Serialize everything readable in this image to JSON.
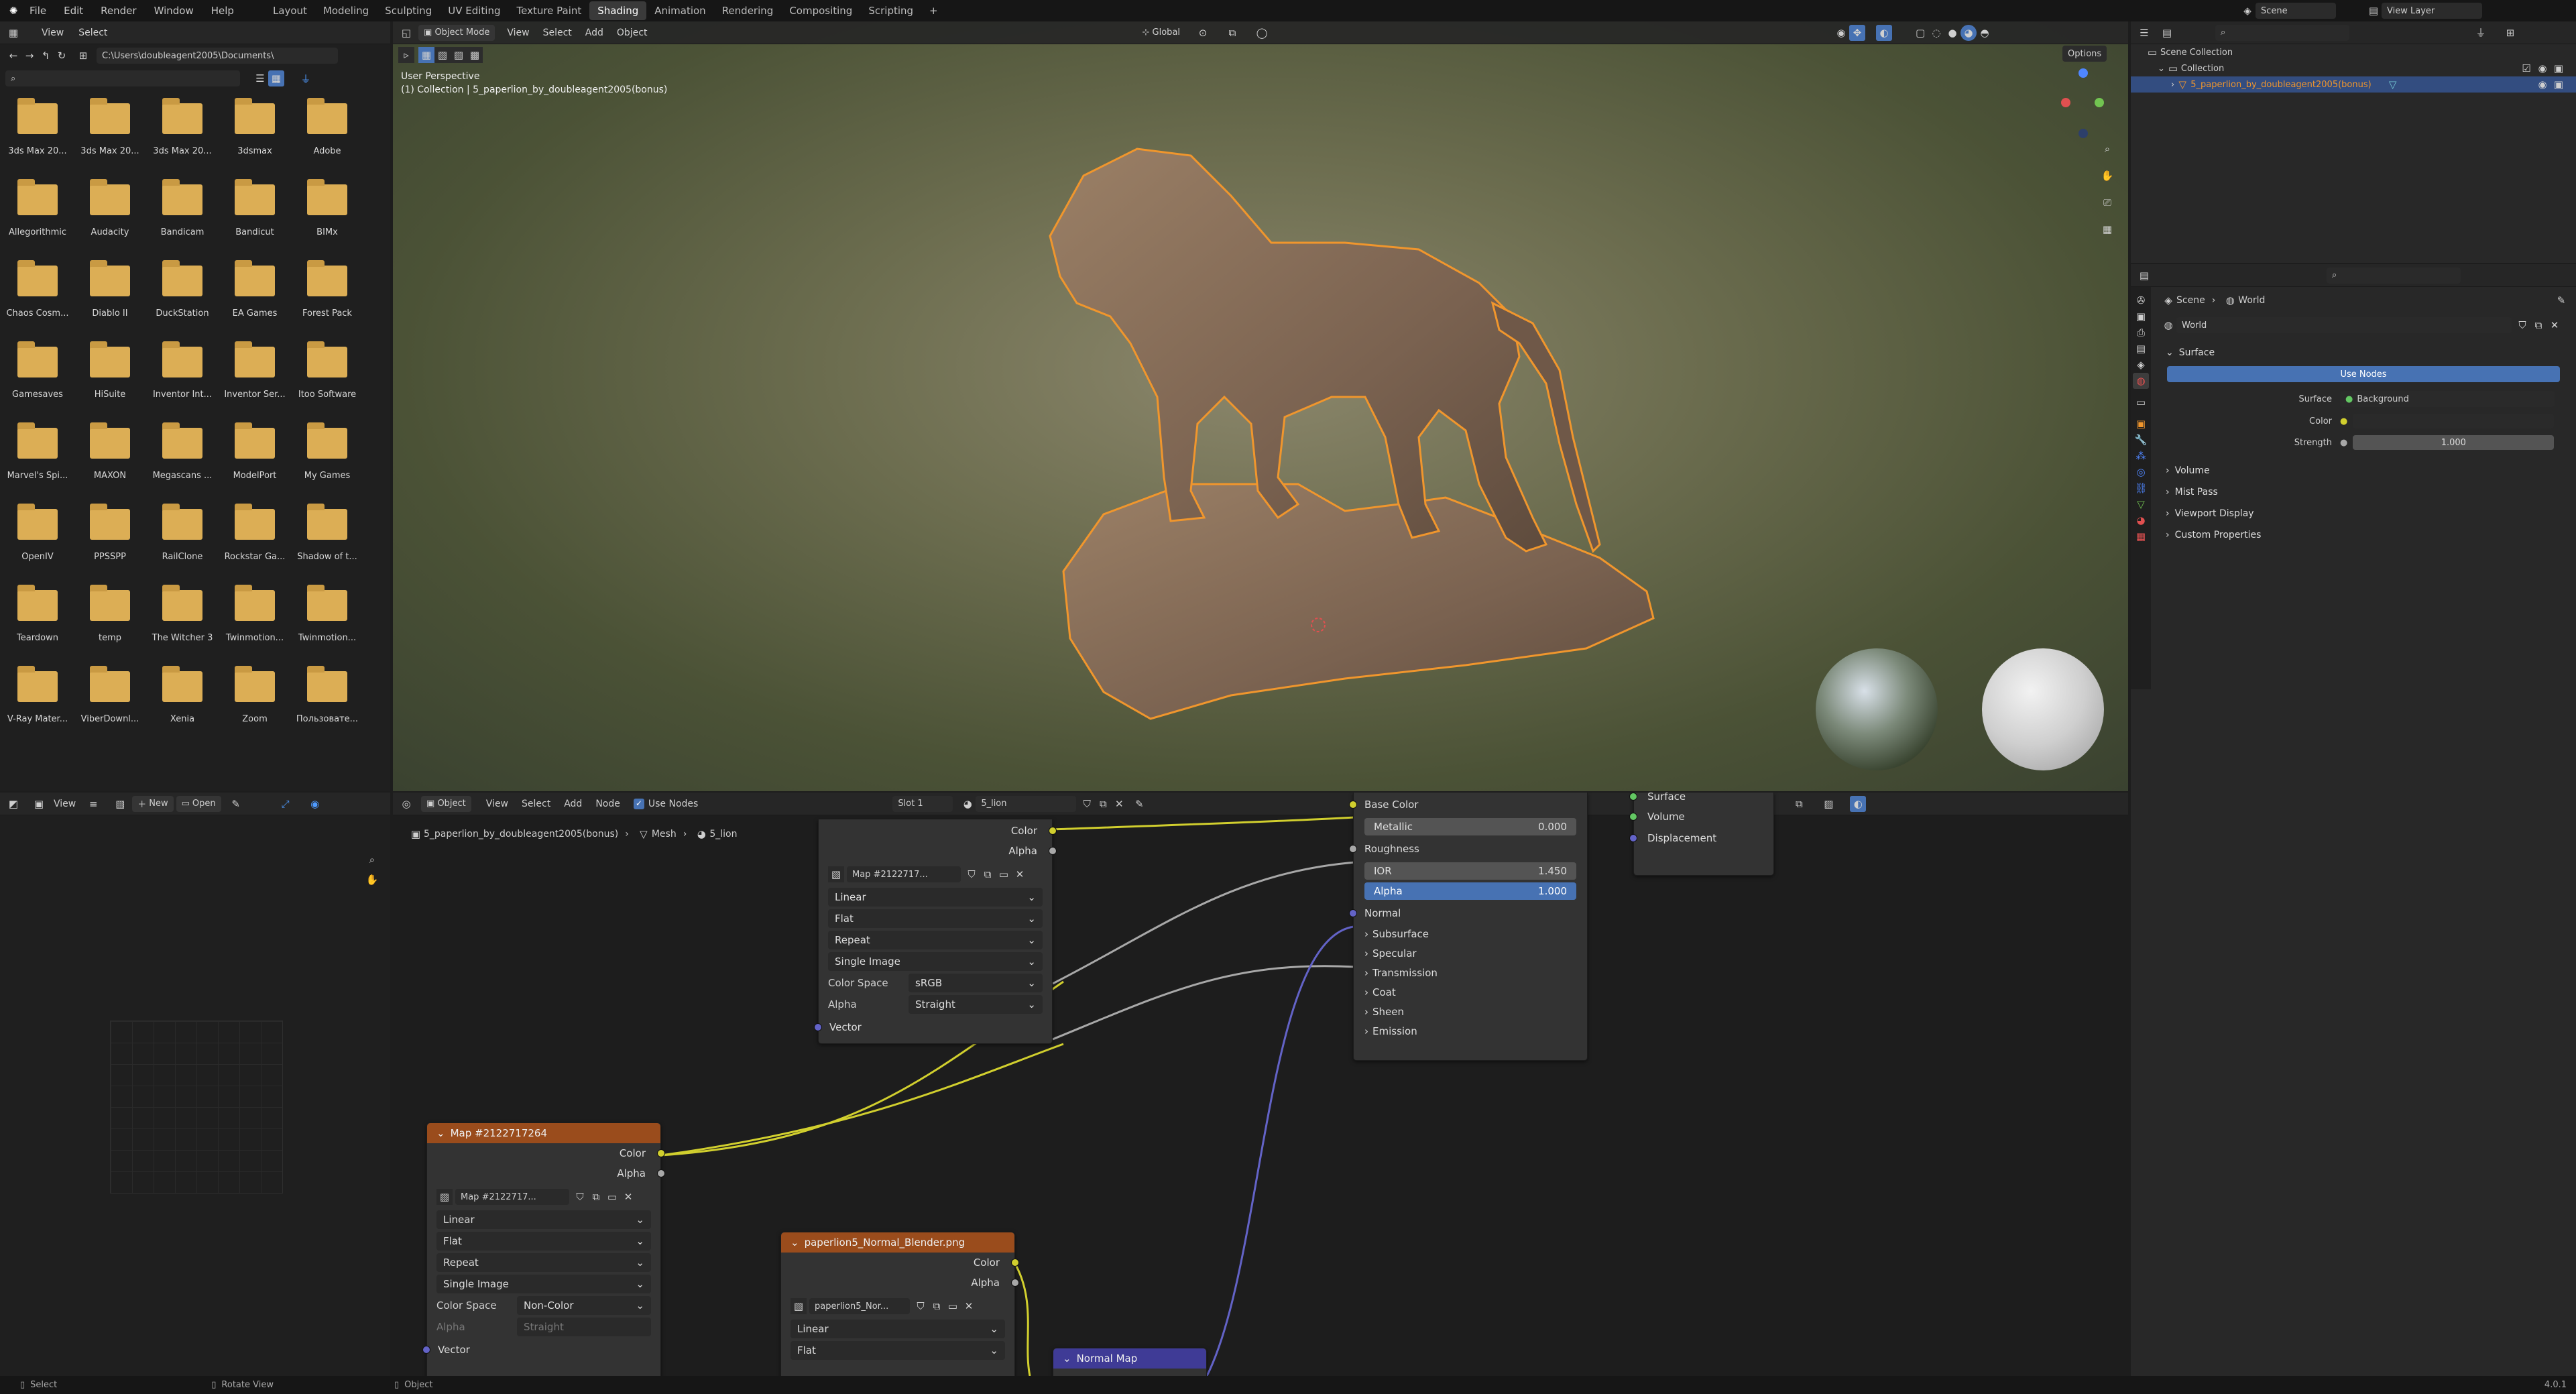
{
  "menubar": {
    "items": [
      "File",
      "Edit",
      "Render",
      "Window",
      "Help"
    ],
    "workspaces": [
      "Layout",
      "Modeling",
      "Sculpting",
      "UV Editing",
      "Texture Paint",
      "Shading",
      "Animation",
      "Rendering",
      "Compositing",
      "Scripting"
    ],
    "active_workspace": "Shading",
    "add": "+",
    "scene_label": "Scene",
    "view_layer_label": "View Layer"
  },
  "filebrowser": {
    "header_menus": [
      "View",
      "Select"
    ],
    "path": "C:\\Users\\doubleagent2005\\Documents\\",
    "folders": [
      "3ds Max 20...",
      "3ds Max 20...",
      "3ds Max 20...",
      "3dsmax",
      "Adobe",
      "Allegorithmic",
      "Audacity",
      "Bandicam",
      "Bandicut",
      "BIMx",
      "Chaos Cosm...",
      "Diablo II",
      "DuckStation",
      "EA Games",
      "Forest Pack",
      "Gamesaves",
      "HiSuite",
      "Inventor Int...",
      "Inventor Ser...",
      "Itoo Software",
      "Marvel's Spi...",
      "MAXON",
      "Megascans ...",
      "ModelPort",
      "My Games",
      "OpenIV",
      "PPSSPP",
      "RailClone",
      "Rockstar Ga...",
      "Shadow of t...",
      "Teardown",
      "temp",
      "The Witcher 3",
      "Twinmotion...",
      "Twinmotion...",
      "V-Ray Mater...",
      "ViberDownl...",
      "Xenia",
      "Zoom",
      "Пользовате..."
    ]
  },
  "viewport": {
    "mode": "Object Mode",
    "menus": [
      "View",
      "Select",
      "Add",
      "Object"
    ],
    "transform": "Global",
    "perspective": "User Perspective",
    "collection_info": "(1) Collection | 5_paperlion_by_doubleagent2005(bonus)",
    "options": "Options"
  },
  "imageeditor": {
    "menus": [
      "View"
    ],
    "new_label": "New",
    "open_label": "Open"
  },
  "nodeeditor": {
    "mode": "Object",
    "menus": [
      "View",
      "Select",
      "Add",
      "Node"
    ],
    "use_nodes": "Use Nodes",
    "slot": "Slot 1",
    "material": "5_lion",
    "breadcrumb": [
      "5_paperlion_by_doubleagent2005(bonus)",
      "Mesh",
      "5_lion"
    ]
  },
  "node_top": {
    "outputs": [
      "Color",
      "Alpha"
    ],
    "image": "Map #2122717...",
    "options": [
      "Linear",
      "Flat",
      "Repeat",
      "Single Image"
    ],
    "color_space_label": "Color Space",
    "color_space": "sRGB",
    "alpha_label": "Alpha",
    "alpha": "Straight",
    "vector": "Vector"
  },
  "node_left": {
    "title": "Map #2122717264",
    "outputs": [
      "Color",
      "Alpha"
    ],
    "image": "Map #2122717...",
    "options": [
      "Linear",
      "Flat",
      "Repeat",
      "Single Image"
    ],
    "color_space_label": "Color Space",
    "color_space": "Non-Color",
    "alpha_label": "Alpha",
    "alpha": "Straight",
    "vector": "Vector"
  },
  "node_normal_img": {
    "title": "paperlion5_Normal_Blender.png",
    "outputs": [
      "Color",
      "Alpha"
    ],
    "image": "paperlion5_Nor...",
    "options": [
      "Linear",
      "Flat"
    ]
  },
  "node_normalmap": {
    "title": "Normal Map"
  },
  "node_bsdf": {
    "base_color": "Base Color",
    "metallic_label": "Metallic",
    "metallic": "0.000",
    "roughness": "Roughness",
    "ior_label": "IOR",
    "ior": "1.450",
    "alpha_label": "Alpha",
    "alpha": "1.000",
    "normal": "Normal",
    "panels": [
      "Subsurface",
      "Specular",
      "Transmission",
      "Coat",
      "Sheen",
      "Emission"
    ]
  },
  "node_output": {
    "inputs": [
      "Surface",
      "Volume",
      "Displacement"
    ]
  },
  "outliner": {
    "items": [
      "Scene Collection",
      "Collection",
      "5_paperlion_by_doubleagent2005(bonus)"
    ]
  },
  "properties": {
    "breadcrumb": [
      "Scene",
      "World"
    ],
    "world_name": "World",
    "surface_panel": "Surface",
    "use_nodes": "Use Nodes",
    "surface_label": "Surface",
    "surface_value": "Background",
    "color_label": "Color",
    "strength_label": "Strength",
    "strength": "1.000",
    "collapsed": [
      "Volume",
      "Mist Pass",
      "Viewport Display",
      "Custom Properties"
    ]
  },
  "statusbar": {
    "items": [
      "Select",
      "Rotate View",
      "Object"
    ],
    "version": "4.0.1"
  }
}
